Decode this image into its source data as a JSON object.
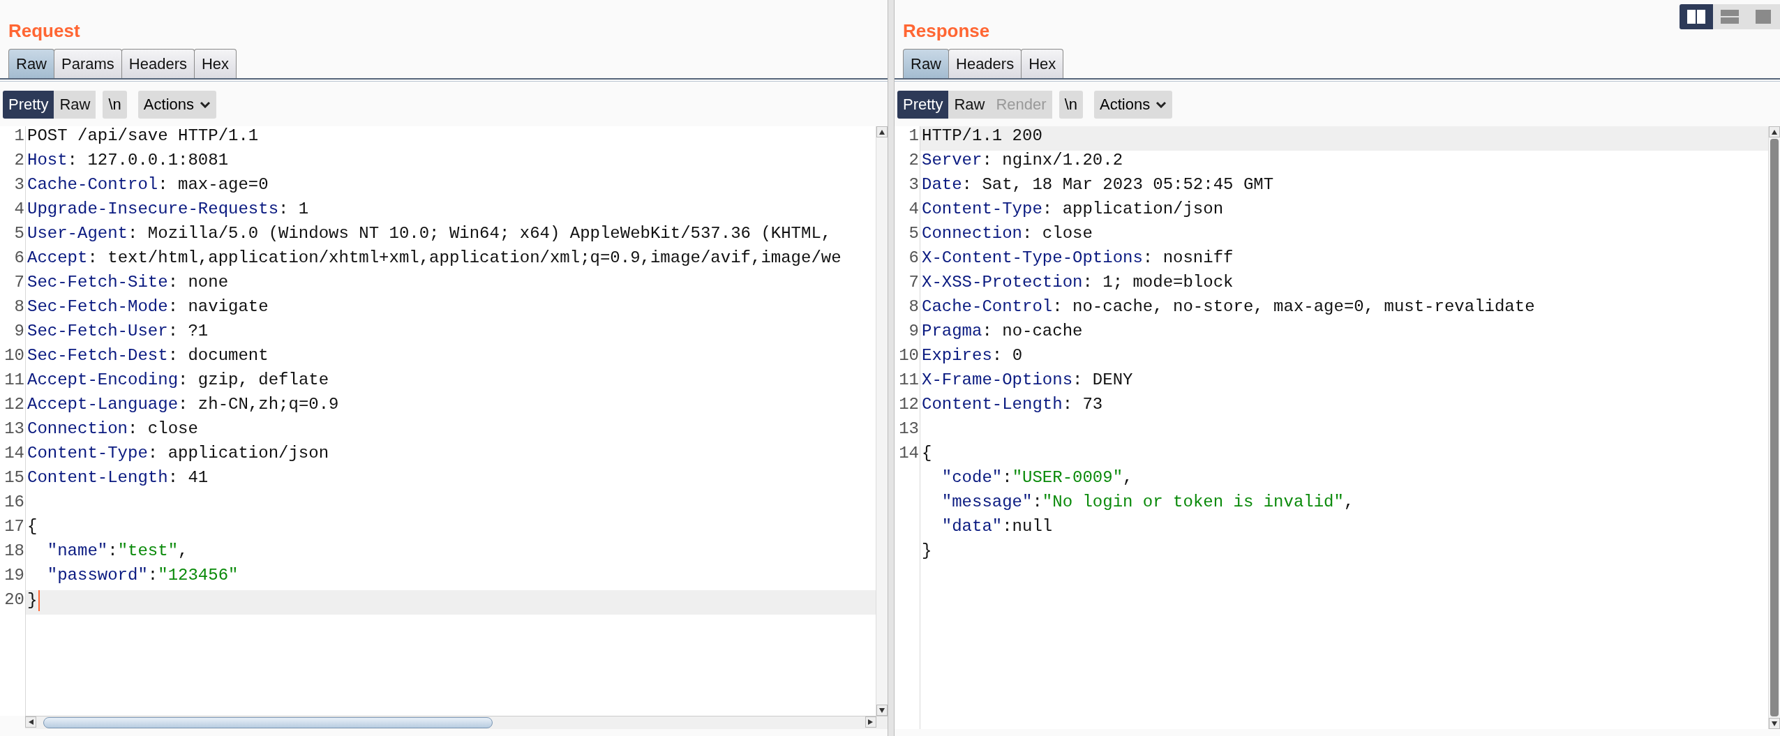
{
  "layout_toggle": [
    {
      "kind": "columns",
      "selected": true
    },
    {
      "kind": "rows",
      "selected": false
    },
    {
      "kind": "single",
      "selected": false
    }
  ],
  "request": {
    "title": "Request",
    "tabs": [
      {
        "label": "Raw",
        "selected": true
      },
      {
        "label": "Params",
        "selected": false
      },
      {
        "label": "Headers",
        "selected": false
      },
      {
        "label": "Hex",
        "selected": false
      }
    ],
    "view_buttons": [
      {
        "label": "Pretty",
        "selected": true,
        "disabled": false
      },
      {
        "label": "Raw",
        "selected": false,
        "disabled": false
      }
    ],
    "newline_button": "\\n",
    "actions_button": "Actions",
    "cursor_shown": true,
    "horizontal_scrollbar": true,
    "lines": [
      {
        "number": "1",
        "current": false,
        "parts": [
          {
            "kind": "text",
            "text": "POST /api/save HTTP/1.1"
          }
        ]
      },
      {
        "number": "2",
        "current": false,
        "parts": [
          {
            "kind": "name",
            "text": "Host"
          },
          {
            "kind": "text",
            "text": ": 127.0.0.1:8081"
          }
        ]
      },
      {
        "number": "3",
        "current": false,
        "parts": [
          {
            "kind": "name",
            "text": "Cache-Control"
          },
          {
            "kind": "text",
            "text": ": max-age=0"
          }
        ]
      },
      {
        "number": "4",
        "current": false,
        "parts": [
          {
            "kind": "name",
            "text": "Upgrade-Insecure-Requests"
          },
          {
            "kind": "text",
            "text": ": 1"
          }
        ]
      },
      {
        "number": "5",
        "current": false,
        "parts": [
          {
            "kind": "name",
            "text": "User-Agent"
          },
          {
            "kind": "text",
            "text": ": Mozilla/5.0 (Windows NT 10.0; Win64; x64) AppleWebKit/537.36 (KHTML,"
          }
        ]
      },
      {
        "number": "6",
        "current": false,
        "parts": [
          {
            "kind": "name",
            "text": "Accept"
          },
          {
            "kind": "text",
            "text": ": text/html,application/xhtml+xml,application/xml;q=0.9,image/avif,image/we"
          }
        ]
      },
      {
        "number": "7",
        "current": false,
        "parts": [
          {
            "kind": "name",
            "text": "Sec-Fetch-Site"
          },
          {
            "kind": "text",
            "text": ": none"
          }
        ]
      },
      {
        "number": "8",
        "current": false,
        "parts": [
          {
            "kind": "name",
            "text": "Sec-Fetch-Mode"
          },
          {
            "kind": "text",
            "text": ": navigate"
          }
        ]
      },
      {
        "number": "9",
        "current": false,
        "parts": [
          {
            "kind": "name",
            "text": "Sec-Fetch-User"
          },
          {
            "kind": "text",
            "text": ": ?1"
          }
        ]
      },
      {
        "number": "10",
        "current": false,
        "parts": [
          {
            "kind": "name",
            "text": "Sec-Fetch-Dest"
          },
          {
            "kind": "text",
            "text": ": document"
          }
        ]
      },
      {
        "number": "11",
        "current": false,
        "parts": [
          {
            "kind": "name",
            "text": "Accept-Encoding"
          },
          {
            "kind": "text",
            "text": ": gzip, deflate"
          }
        ]
      },
      {
        "number": "12",
        "current": false,
        "parts": [
          {
            "kind": "name",
            "text": "Accept-Language"
          },
          {
            "kind": "text",
            "text": ": zh-CN,zh;q=0.9"
          }
        ]
      },
      {
        "number": "13",
        "current": false,
        "parts": [
          {
            "kind": "name",
            "text": "Connection"
          },
          {
            "kind": "text",
            "text": ": close"
          }
        ]
      },
      {
        "number": "14",
        "current": false,
        "parts": [
          {
            "kind": "name",
            "text": "Content-Type"
          },
          {
            "kind": "text",
            "text": ": application/json"
          }
        ]
      },
      {
        "number": "15",
        "current": false,
        "parts": [
          {
            "kind": "name",
            "text": "Content-Length"
          },
          {
            "kind": "text",
            "text": ": 41"
          }
        ]
      },
      {
        "number": "16",
        "current": false
      },
      {
        "number": "17",
        "current": false,
        "parts": [
          {
            "kind": "text",
            "text": "{"
          }
        ]
      },
      {
        "number": "18",
        "current": false,
        "parts": [
          {
            "kind": "key",
            "text": "  \"name\""
          },
          {
            "kind": "text",
            "text": ":"
          },
          {
            "kind": "string",
            "text": "\"test\""
          },
          {
            "kind": "text",
            "text": ","
          }
        ]
      },
      {
        "number": "19",
        "current": false,
        "parts": [
          {
            "kind": "key",
            "text": "  \"password\""
          },
          {
            "kind": "text",
            "text": ":"
          },
          {
            "kind": "string",
            "text": "\"123456\""
          }
        ]
      },
      {
        "number": "20",
        "current": true,
        "parts": [
          {
            "kind": "text",
            "text": "}"
          }
        ]
      }
    ]
  },
  "response": {
    "title": "Response",
    "tabs": [
      {
        "label": "Raw",
        "selected": true
      },
      {
        "label": "Headers",
        "selected": false
      },
      {
        "label": "Hex",
        "selected": false
      }
    ],
    "view_buttons": [
      {
        "label": "Pretty",
        "selected": true,
        "disabled": false
      },
      {
        "label": "Raw",
        "selected": false,
        "disabled": false
      },
      {
        "label": "Render",
        "selected": false,
        "disabled": true
      }
    ],
    "newline_button": "\\n",
    "actions_button": "Actions",
    "horizontal_scrollbar": false,
    "lines": [
      {
        "number": "1",
        "current": true,
        "parts": [
          {
            "kind": "text",
            "text": "HTTP/1.1 200"
          }
        ]
      },
      {
        "number": "2",
        "current": false,
        "parts": [
          {
            "kind": "name",
            "text": "Server"
          },
          {
            "kind": "text",
            "text": ": nginx/1.20.2"
          }
        ]
      },
      {
        "number": "3",
        "current": false,
        "parts": [
          {
            "kind": "name",
            "text": "Date"
          },
          {
            "kind": "text",
            "text": ": Sat, 18 Mar 2023 05:52:45 GMT"
          }
        ]
      },
      {
        "number": "4",
        "current": false,
        "parts": [
          {
            "kind": "name",
            "text": "Content-Type"
          },
          {
            "kind": "text",
            "text": ": application/json"
          }
        ]
      },
      {
        "number": "5",
        "current": false,
        "parts": [
          {
            "kind": "name",
            "text": "Connection"
          },
          {
            "kind": "text",
            "text": ": close"
          }
        ]
      },
      {
        "number": "6",
        "current": false,
        "parts": [
          {
            "kind": "name",
            "text": "X-Content-Type-Options"
          },
          {
            "kind": "text",
            "text": ": nosniff"
          }
        ]
      },
      {
        "number": "7",
        "current": false,
        "parts": [
          {
            "kind": "name",
            "text": "X-XSS-Protection"
          },
          {
            "kind": "text",
            "text": ": 1; mode=block"
          }
        ]
      },
      {
        "number": "8",
        "current": false,
        "parts": [
          {
            "kind": "name",
            "text": "Cache-Control"
          },
          {
            "kind": "text",
            "text": ": no-cache, no-store, max-age=0, must-revalidate"
          }
        ]
      },
      {
        "number": "9",
        "current": false,
        "parts": [
          {
            "kind": "name",
            "text": "Pragma"
          },
          {
            "kind": "text",
            "text": ": no-cache"
          }
        ]
      },
      {
        "number": "10",
        "current": false,
        "parts": [
          {
            "kind": "name",
            "text": "Expires"
          },
          {
            "kind": "text",
            "text": ": 0"
          }
        ]
      },
      {
        "number": "11",
        "current": false,
        "parts": [
          {
            "kind": "name",
            "text": "X-Frame-Options"
          },
          {
            "kind": "text",
            "text": ": DENY"
          }
        ]
      },
      {
        "number": "12",
        "current": false,
        "parts": [
          {
            "kind": "name",
            "text": "Content-Length"
          },
          {
            "kind": "text",
            "text": ": 73"
          }
        ]
      },
      {
        "number": "13",
        "current": false
      },
      {
        "number": "14",
        "current": false,
        "parts": [
          {
            "kind": "text",
            "text": "{"
          }
        ]
      },
      {
        "current": false,
        "parts": [
          {
            "kind": "key",
            "text": "  \"code\""
          },
          {
            "kind": "text",
            "text": ":"
          },
          {
            "kind": "string",
            "text": "\"USER-0009\""
          },
          {
            "kind": "text",
            "text": ","
          }
        ]
      },
      {
        "current": false,
        "parts": [
          {
            "kind": "key",
            "text": "  \"message\""
          },
          {
            "kind": "text",
            "text": ":"
          },
          {
            "kind": "string",
            "text": "\"No login or token is invalid\""
          },
          {
            "kind": "text",
            "text": ","
          }
        ]
      },
      {
        "current": false,
        "parts": [
          {
            "kind": "key",
            "text": "  \"data\""
          },
          {
            "kind": "text",
            "text": ":null"
          }
        ]
      },
      {
        "current": false,
        "parts": [
          {
            "kind": "text",
            "text": "}"
          }
        ]
      }
    ]
  }
}
